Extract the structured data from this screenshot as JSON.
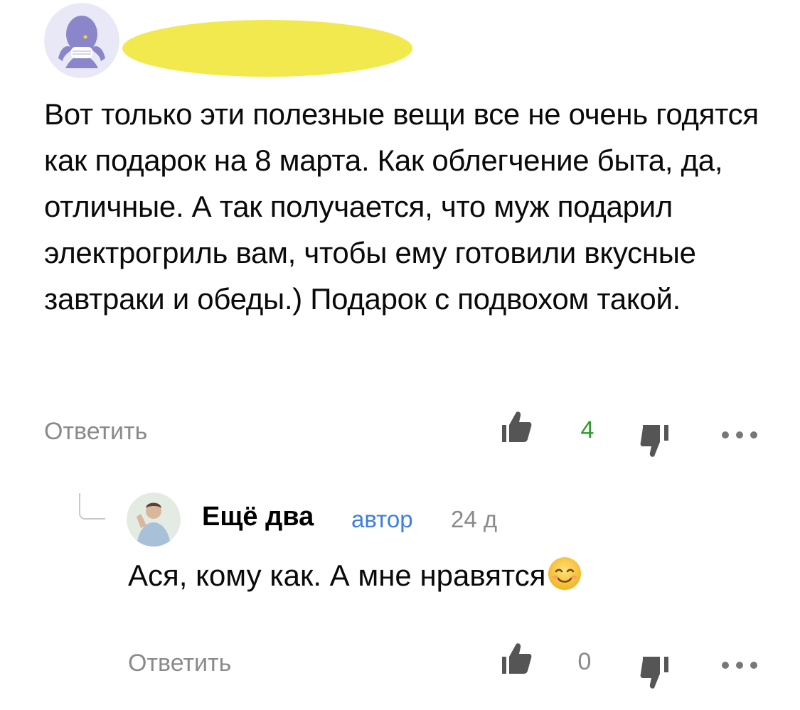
{
  "comment": {
    "author_redacted": true,
    "text": "Вот только эти полезные вещи все не очень годятся как подарок на 8 марта. Как облегчение быта, да, отличные. А так получается, что муж подарил электрогриль вам, чтобы ему готовили вкусные завтраки и обеды.) Подарок с подвохом такой.",
    "reply_label": "Ответить",
    "likes": "4",
    "like_icon": "thumbs-up-icon",
    "dislike_icon": "thumbs-down-icon",
    "more_icon": "more-dots-icon",
    "likes_color": "#2e9b2e"
  },
  "reply": {
    "author": "Ещё два",
    "badge": "автор",
    "time": "24 д",
    "text": "Ася, кому как. А мне нравятся",
    "emoji": "smiling-face-icon",
    "reply_label": "Ответить",
    "likes": "0"
  },
  "colors": {
    "redaction": "#f1e94e",
    "badge": "#3d7ee0",
    "muted": "#8a8a8a",
    "avatar_bg": "#8b86c9"
  }
}
